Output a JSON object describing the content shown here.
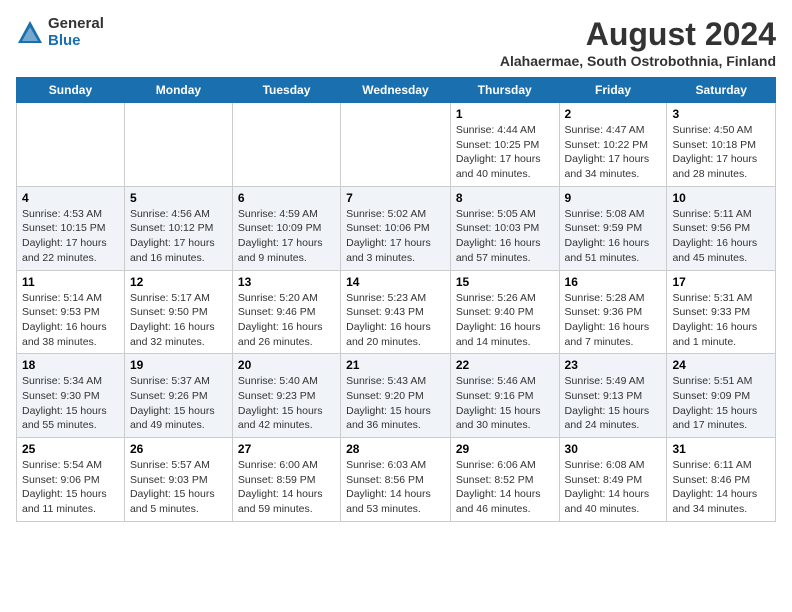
{
  "logo": {
    "general": "General",
    "blue": "Blue"
  },
  "title": "August 2024",
  "subtitle": "Alahaermae, South Ostrobothnia, Finland",
  "days_of_week": [
    "Sunday",
    "Monday",
    "Tuesday",
    "Wednesday",
    "Thursday",
    "Friday",
    "Saturday"
  ],
  "weeks": [
    [
      {
        "day": "",
        "info": ""
      },
      {
        "day": "",
        "info": ""
      },
      {
        "day": "",
        "info": ""
      },
      {
        "day": "",
        "info": ""
      },
      {
        "day": "1",
        "info": "Sunrise: 4:44 AM\nSunset: 10:25 PM\nDaylight: 17 hours and 40 minutes."
      },
      {
        "day": "2",
        "info": "Sunrise: 4:47 AM\nSunset: 10:22 PM\nDaylight: 17 hours and 34 minutes."
      },
      {
        "day": "3",
        "info": "Sunrise: 4:50 AM\nSunset: 10:18 PM\nDaylight: 17 hours and 28 minutes."
      }
    ],
    [
      {
        "day": "4",
        "info": "Sunrise: 4:53 AM\nSunset: 10:15 PM\nDaylight: 17 hours and 22 minutes."
      },
      {
        "day": "5",
        "info": "Sunrise: 4:56 AM\nSunset: 10:12 PM\nDaylight: 17 hours and 16 minutes."
      },
      {
        "day": "6",
        "info": "Sunrise: 4:59 AM\nSunset: 10:09 PM\nDaylight: 17 hours and 9 minutes."
      },
      {
        "day": "7",
        "info": "Sunrise: 5:02 AM\nSunset: 10:06 PM\nDaylight: 17 hours and 3 minutes."
      },
      {
        "day": "8",
        "info": "Sunrise: 5:05 AM\nSunset: 10:03 PM\nDaylight: 16 hours and 57 minutes."
      },
      {
        "day": "9",
        "info": "Sunrise: 5:08 AM\nSunset: 9:59 PM\nDaylight: 16 hours and 51 minutes."
      },
      {
        "day": "10",
        "info": "Sunrise: 5:11 AM\nSunset: 9:56 PM\nDaylight: 16 hours and 45 minutes."
      }
    ],
    [
      {
        "day": "11",
        "info": "Sunrise: 5:14 AM\nSunset: 9:53 PM\nDaylight: 16 hours and 38 minutes."
      },
      {
        "day": "12",
        "info": "Sunrise: 5:17 AM\nSunset: 9:50 PM\nDaylight: 16 hours and 32 minutes."
      },
      {
        "day": "13",
        "info": "Sunrise: 5:20 AM\nSunset: 9:46 PM\nDaylight: 16 hours and 26 minutes."
      },
      {
        "day": "14",
        "info": "Sunrise: 5:23 AM\nSunset: 9:43 PM\nDaylight: 16 hours and 20 minutes."
      },
      {
        "day": "15",
        "info": "Sunrise: 5:26 AM\nSunset: 9:40 PM\nDaylight: 16 hours and 14 minutes."
      },
      {
        "day": "16",
        "info": "Sunrise: 5:28 AM\nSunset: 9:36 PM\nDaylight: 16 hours and 7 minutes."
      },
      {
        "day": "17",
        "info": "Sunrise: 5:31 AM\nSunset: 9:33 PM\nDaylight: 16 hours and 1 minute."
      }
    ],
    [
      {
        "day": "18",
        "info": "Sunrise: 5:34 AM\nSunset: 9:30 PM\nDaylight: 15 hours and 55 minutes."
      },
      {
        "day": "19",
        "info": "Sunrise: 5:37 AM\nSunset: 9:26 PM\nDaylight: 15 hours and 49 minutes."
      },
      {
        "day": "20",
        "info": "Sunrise: 5:40 AM\nSunset: 9:23 PM\nDaylight: 15 hours and 42 minutes."
      },
      {
        "day": "21",
        "info": "Sunrise: 5:43 AM\nSunset: 9:20 PM\nDaylight: 15 hours and 36 minutes."
      },
      {
        "day": "22",
        "info": "Sunrise: 5:46 AM\nSunset: 9:16 PM\nDaylight: 15 hours and 30 minutes."
      },
      {
        "day": "23",
        "info": "Sunrise: 5:49 AM\nSunset: 9:13 PM\nDaylight: 15 hours and 24 minutes."
      },
      {
        "day": "24",
        "info": "Sunrise: 5:51 AM\nSunset: 9:09 PM\nDaylight: 15 hours and 17 minutes."
      }
    ],
    [
      {
        "day": "25",
        "info": "Sunrise: 5:54 AM\nSunset: 9:06 PM\nDaylight: 15 hours and 11 minutes."
      },
      {
        "day": "26",
        "info": "Sunrise: 5:57 AM\nSunset: 9:03 PM\nDaylight: 15 hours and 5 minutes."
      },
      {
        "day": "27",
        "info": "Sunrise: 6:00 AM\nSunset: 8:59 PM\nDaylight: 14 hours and 59 minutes."
      },
      {
        "day": "28",
        "info": "Sunrise: 6:03 AM\nSunset: 8:56 PM\nDaylight: 14 hours and 53 minutes."
      },
      {
        "day": "29",
        "info": "Sunrise: 6:06 AM\nSunset: 8:52 PM\nDaylight: 14 hours and 46 minutes."
      },
      {
        "day": "30",
        "info": "Sunrise: 6:08 AM\nSunset: 8:49 PM\nDaylight: 14 hours and 40 minutes."
      },
      {
        "day": "31",
        "info": "Sunrise: 6:11 AM\nSunset: 8:46 PM\nDaylight: 14 hours and 34 minutes."
      }
    ]
  ]
}
